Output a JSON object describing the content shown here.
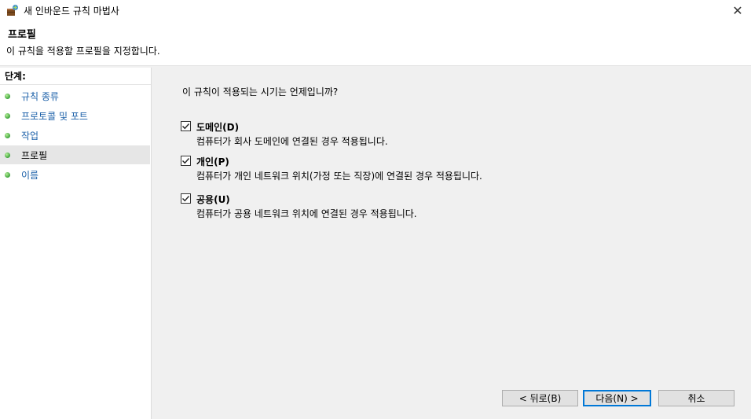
{
  "window": {
    "title": "새 인바운드 규칙 마법사",
    "close_glyph": "✕"
  },
  "header": {
    "title": "프로필",
    "subtitle": "이 규칙을 적용할 프로필을 지정합니다."
  },
  "sidebar": {
    "heading": "단계:",
    "items": [
      {
        "label": "규칙 종류",
        "icon": "green-dot-icon",
        "active": false
      },
      {
        "label": "프로토콜 및 포트",
        "icon": "green-dot-icon",
        "active": false
      },
      {
        "label": "작업",
        "icon": "green-dot-icon",
        "active": false
      },
      {
        "label": "프로필",
        "icon": "green-dot-icon",
        "active": true
      },
      {
        "label": "이름",
        "icon": "green-dot-icon",
        "active": false
      }
    ]
  },
  "main": {
    "question": "이 규칙이 적용되는 시기는 언제입니까?",
    "options": [
      {
        "label": "도메인(D)",
        "description": "컴퓨터가 회사 도메인에 연결된 경우 적용됩니다.",
        "checked": true
      },
      {
        "label": "개인(P)",
        "description": "컴퓨터가 개인 네트워크 위치(가정 또는 직장)에 연결된 경우 적용됩니다.",
        "checked": true
      },
      {
        "label": "공용(U)",
        "description": "컴퓨터가 공용 네트워크 위치에 연결된 경우 적용됩니다.",
        "checked": true
      }
    ]
  },
  "buttons": {
    "back": "< 뒤로(B)",
    "next": "다음(N) >",
    "cancel": "취소"
  },
  "colors": {
    "link": "#1a5fa8",
    "step_dot": "#3ca33a",
    "default_button_border": "#0078d7"
  }
}
